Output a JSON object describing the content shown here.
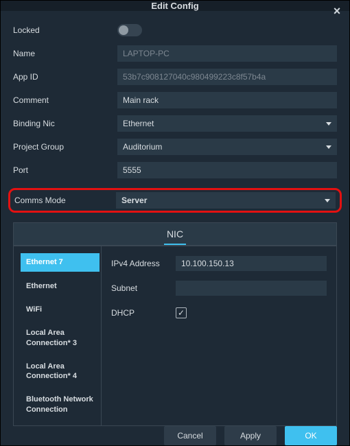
{
  "dialog": {
    "title": "Edit Config"
  },
  "form": {
    "locked": {
      "label": "Locked",
      "value": false
    },
    "name": {
      "label": "Name",
      "value": "LAPTOP-PC"
    },
    "appId": {
      "label": "App ID",
      "value": "53b7c908127040c980499223c8f57b4a"
    },
    "comment": {
      "label": "Comment",
      "value": "Main rack"
    },
    "bindingNic": {
      "label": "Binding Nic",
      "value": "Ethernet"
    },
    "projectGroup": {
      "label": "Project Group",
      "value": "Auditorium"
    },
    "port": {
      "label": "Port",
      "value": "5555"
    },
    "commsMode": {
      "label": "Comms Mode",
      "value": "Server"
    }
  },
  "nic": {
    "header": "NIC",
    "items": [
      "Ethernet 7",
      "Ethernet",
      "WiFi",
      "Local Area Connection* 3",
      "Local Area Connection* 4",
      "Bluetooth Network Connection"
    ],
    "selectedIndex": 0,
    "detail": {
      "ipv4": {
        "label": "IPv4 Address",
        "value": "10.100.150.13"
      },
      "subnet": {
        "label": "Subnet",
        "value": ""
      },
      "dhcp": {
        "label": "DHCP",
        "checked": true
      }
    }
  },
  "buttons": {
    "cancel": "Cancel",
    "apply": "Apply",
    "ok": "OK"
  }
}
